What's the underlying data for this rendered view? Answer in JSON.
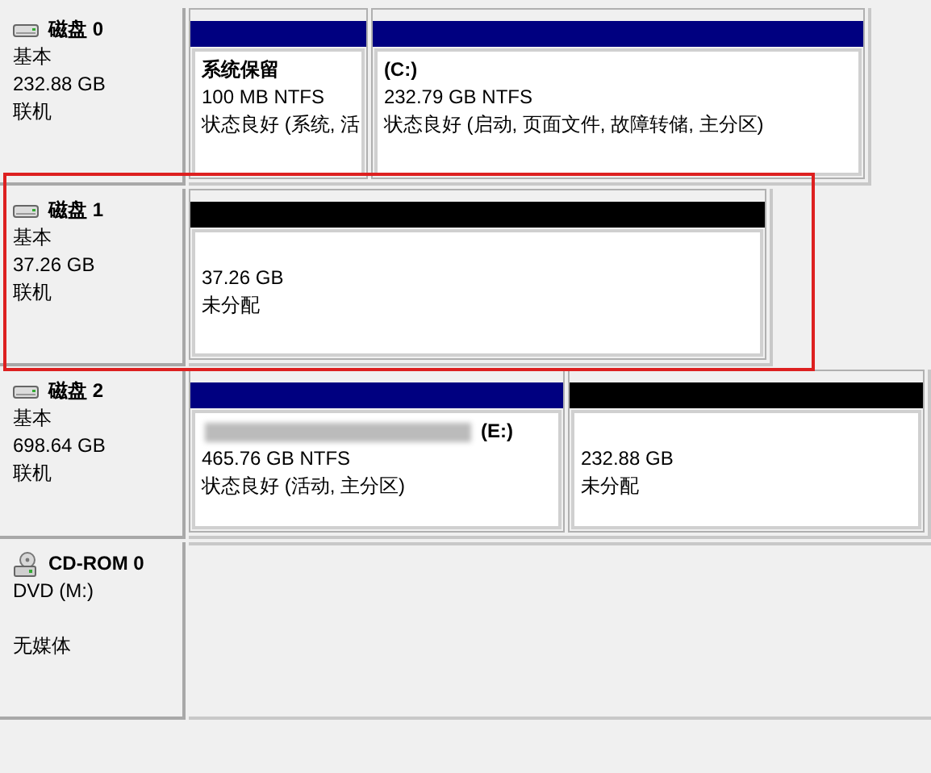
{
  "disks": [
    {
      "kind": "disk",
      "name": "磁盘 0",
      "lines": [
        "基本",
        "232.88 GB",
        "联机"
      ],
      "highlighted": false,
      "partitions": [
        {
          "kind": "primary",
          "label": "系统保留",
          "lines": [
            "100 MB NTFS",
            "状态良好 (系统, 活"
          ]
        },
        {
          "kind": "primary",
          "label": "(C:)",
          "lines": [
            "232.79 GB NTFS",
            "状态良好 (启动, 页面文件, 故障转储, 主分区)"
          ]
        }
      ]
    },
    {
      "kind": "disk",
      "name": "磁盘 1",
      "lines": [
        "基本",
        "37.26 GB",
        "联机"
      ],
      "highlighted": true,
      "partitions": [
        {
          "kind": "unallocated",
          "lines": [
            "37.26 GB",
            "未分配"
          ]
        }
      ]
    },
    {
      "kind": "disk",
      "name": "磁盘 2",
      "lines": [
        "基本",
        "698.64 GB",
        "联机"
      ],
      "highlighted": false,
      "partitions": [
        {
          "kind": "primary",
          "label": "(E:)",
          "label_blurred": true,
          "lines": [
            "465.76 GB NTFS",
            "状态良好 (活动, 主分区)"
          ]
        },
        {
          "kind": "unallocated",
          "lines": [
            "232.88 GB",
            "未分配"
          ]
        }
      ]
    },
    {
      "kind": "cdrom",
      "name": "CD-ROM 0",
      "lines": [
        "DVD (M:)",
        "无媒体"
      ],
      "highlighted": false
    }
  ]
}
